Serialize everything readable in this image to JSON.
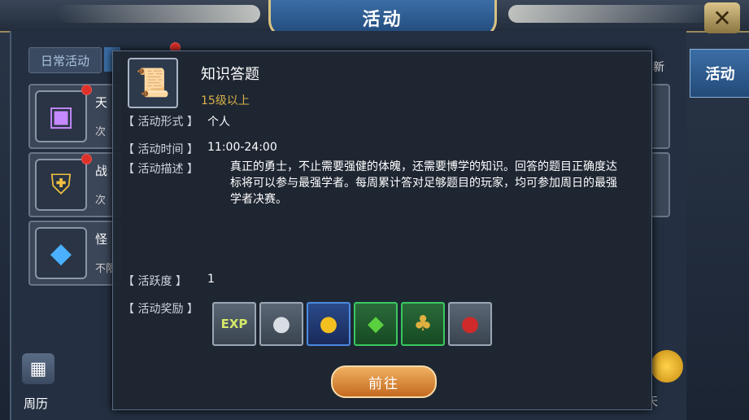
{
  "window": {
    "title": "活动",
    "close_label": "✕"
  },
  "tabs": {
    "daily": "日常活动"
  },
  "list": [
    {
      "label": "天",
      "sub": "次"
    },
    {
      "label": "战",
      "sub": "次"
    },
    {
      "label": "怪",
      "sub": "不限"
    }
  ],
  "right": {
    "tab": "活动",
    "new_label": "新",
    "day_label": "天"
  },
  "calendar": {
    "label": "周历"
  },
  "modal": {
    "title": "知识答题",
    "level": "15级以上",
    "form_label": "【 活动形式 】",
    "form_value": "个人",
    "time_label": "【 活动时间 】",
    "time_value": "11:00-24:00",
    "desc_label": "【 活动描述 】",
    "desc_value": "真正的勇士，不止需要强健的体魄，还需要博学的知识。回答的题目正确度达标将可以参与最强学者。每周累计答对足够题目的玩家，均可参加周日的最强学者决赛。",
    "activity_label": "【 活跃度 】",
    "activity_value": "1",
    "reward_label": "【 活动奖励 】",
    "rewards": [
      {
        "icon": "exp-icon",
        "glyph": "EXP"
      },
      {
        "icon": "silver-coin-icon",
        "glyph": "●"
      },
      {
        "icon": "gold-coin-icon",
        "glyph": "●"
      },
      {
        "icon": "green-gem-icon",
        "glyph": "◆"
      },
      {
        "icon": "wheat-icon",
        "glyph": "♣"
      },
      {
        "icon": "red-bag-icon",
        "glyph": "●"
      }
    ],
    "go_label": "前往"
  }
}
